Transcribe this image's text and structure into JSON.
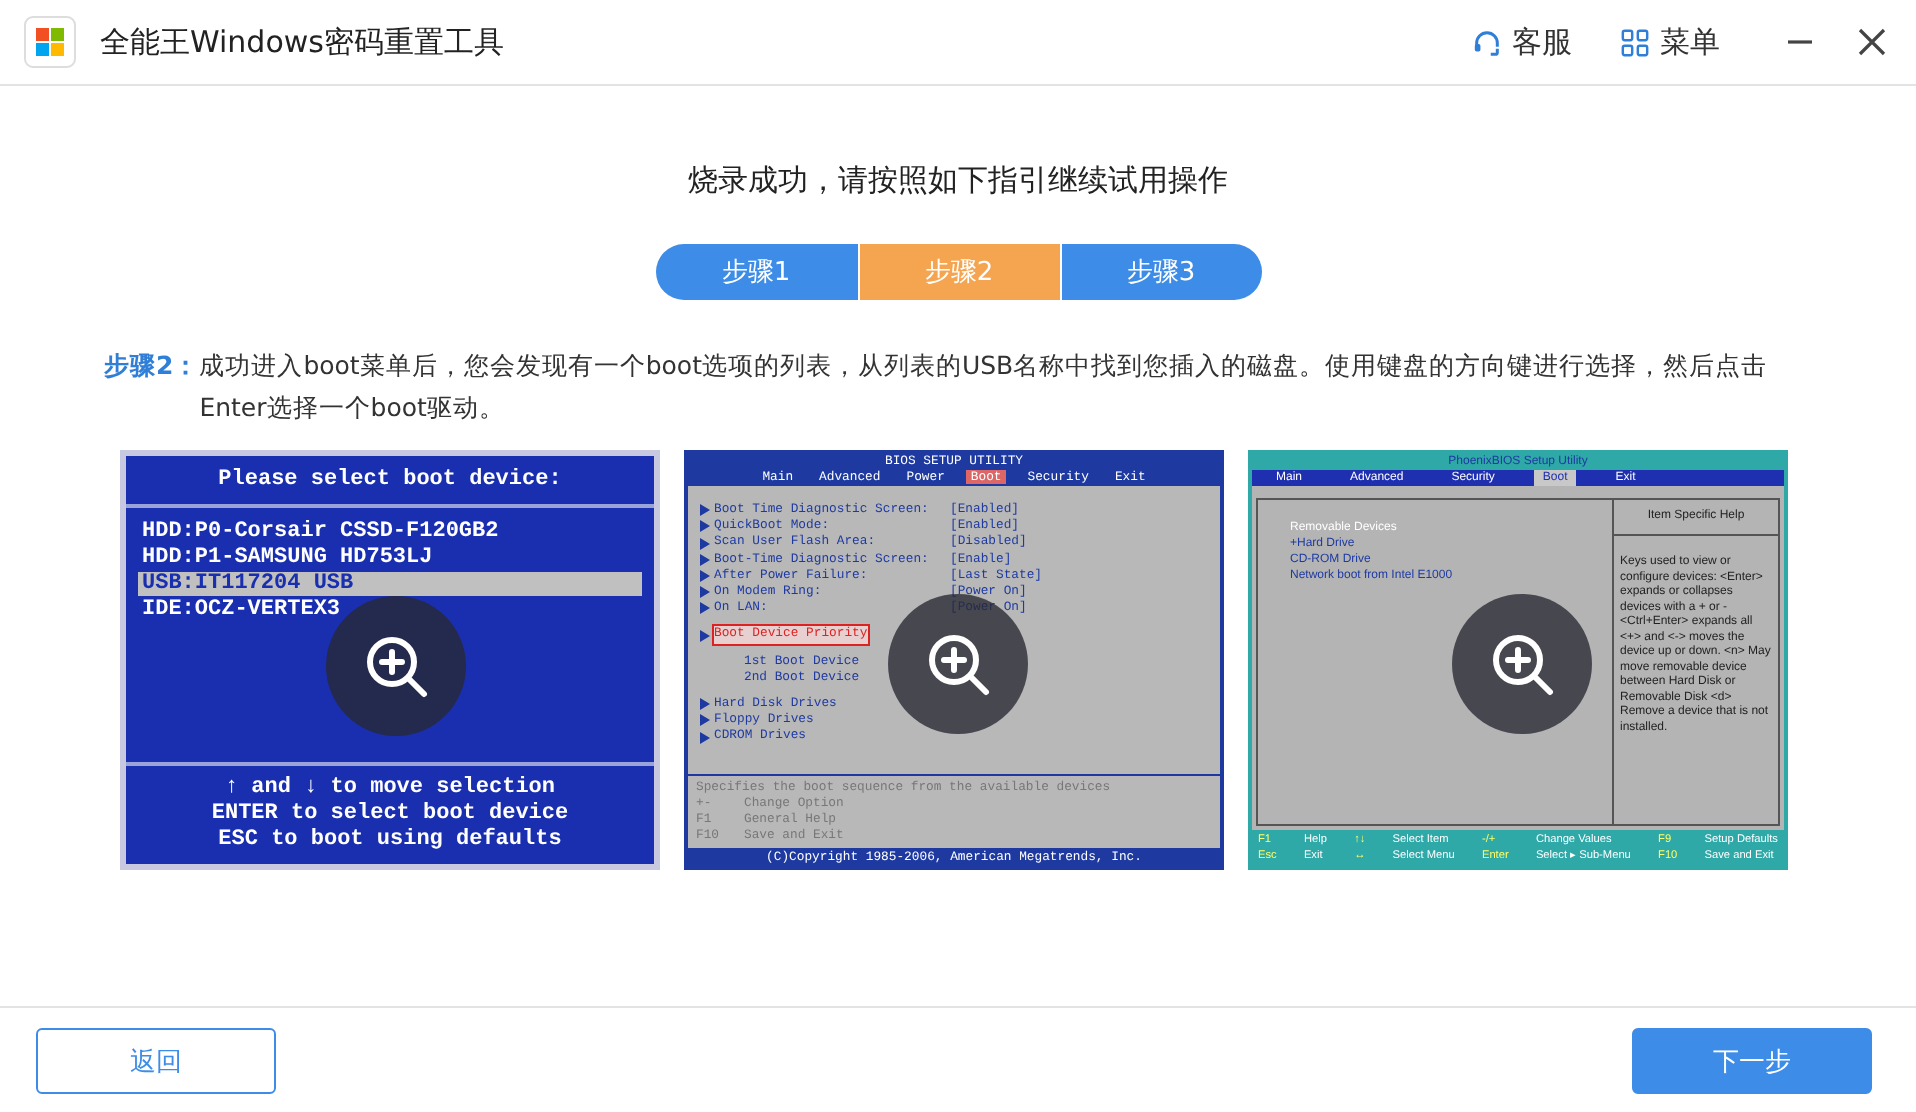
{
  "window": {
    "title": "全能王Windows密码重置工具",
    "actions": [
      {
        "label": "客服",
        "kind": "support"
      },
      {
        "label": "菜单",
        "kind": "menu"
      }
    ]
  },
  "heading": "烧录成功，请按照如下指引继续试用操作",
  "steps": [
    {
      "label": "步骤1",
      "selected": false
    },
    {
      "label": "步骤2",
      "selected": true
    },
    {
      "label": "步骤3",
      "selected": false
    }
  ],
  "instruction": {
    "label": "步骤2：",
    "text": "成功进入boot菜单后，您会发现有一个boot选项的列表，从列表的USB名称中找到您插入的磁盘。使用键盘的方向键进行选择，然后点击Enter选择一个boot驱动。"
  },
  "screenshots": [
    {
      "kind": "boot-menu",
      "title": "Please select boot device:",
      "items": [
        {
          "text": "HDD:P0-Corsair CSSD-F120GB2",
          "selected": false
        },
        {
          "text": "HDD:P1-SAMSUNG HD753LJ",
          "selected": false
        },
        {
          "text": "USB:IT117204 USB",
          "selected": true
        },
        {
          "text": "IDE:OCZ-VERTEX3",
          "selected": false
        }
      ],
      "footer": [
        "↑ and ↓ to move selection",
        "ENTER to select boot device",
        "ESC to boot using defaults"
      ]
    },
    {
      "kind": "ami",
      "title": "BIOS SETUP UTILITY",
      "tabs": [
        {
          "label": "Main",
          "selected": false
        },
        {
          "label": "Advanced",
          "selected": false
        },
        {
          "label": "Power",
          "selected": false
        },
        {
          "label": "Boot",
          "selected": true
        },
        {
          "label": "Security",
          "selected": false
        },
        {
          "label": "Exit",
          "selected": false
        }
      ],
      "groups": [
        {
          "items": [
            {
              "label": "Boot Time Diagnostic Screen:",
              "value": "[Enabled]",
              "kind": "arrow",
              "selected": false
            },
            {
              "label": "QuickBoot Mode:",
              "value": "[Enabled]",
              "kind": "arrow",
              "selected": false
            },
            {
              "label": "Scan User Flash Area:",
              "value": "[Disabled]",
              "kind": "arrow",
              "selected": false
            },
            {
              "label": "Boot-Time Diagnostic Screen:",
              "value": "[Enable]",
              "kind": "arrow",
              "selected": false
            },
            {
              "label": "After Power Failure:",
              "value": "[Last State]",
              "kind": "arrow",
              "selected": false
            },
            {
              "label": "On Modem Ring:",
              "value": "[Power On]",
              "kind": "arrow",
              "selected": false
            },
            {
              "label": "On LAN:",
              "value": "[Power On]",
              "kind": "arrow",
              "selected": false
            }
          ]
        },
        {
          "items": [
            {
              "label": "Boot Device Priority",
              "kind": "arrow",
              "selected": true
            }
          ]
        },
        {
          "items": [
            {
              "label": "1st Boot Device",
              "kind": "sub",
              "selected": false
            },
            {
              "label": "2nd Boot Device",
              "kind": "sub",
              "selected": false
            }
          ]
        },
        {
          "items": [
            {
              "label": "Hard Disk Drives",
              "kind": "arrow",
              "selected": false
            },
            {
              "label": "Floppy Drives",
              "kind": "arrow",
              "selected": false
            },
            {
              "label": "CDROM Drives",
              "kind": "arrow",
              "selected": false
            }
          ]
        }
      ],
      "hint": "Specifies the boot sequence from the available devices",
      "keys": [
        {
          "key": "+-",
          "action": "Change Option"
        },
        {
          "key": "F1",
          "action": "General Help"
        },
        {
          "key": "F10",
          "action": "Save and Exit"
        }
      ],
      "copyright": "(C)Copyright 1985-2006, American Megatrends, Inc."
    },
    {
      "kind": "phoenix",
      "title": "PhoenixBIOS Setup Utility",
      "tabs": [
        {
          "label": "Main",
          "selected": false
        },
        {
          "label": "Advanced",
          "selected": false
        },
        {
          "label": "Security",
          "selected": false
        },
        {
          "label": "Boot",
          "selected": true
        },
        {
          "label": "Exit",
          "selected": false
        }
      ],
      "items": [
        {
          "text": "Removable Devices",
          "selected": true
        },
        {
          "text": "+Hard Drive",
          "selected": false
        },
        {
          "text": "CD-ROM Drive",
          "selected": false
        },
        {
          "text": "Network boot from Intel E1000",
          "selected": false
        }
      ],
      "help_title": "Item Specific Help",
      "help": "Keys used to view or configure devices: <Enter> expands or collapses devices with a + or - <Ctrl+Enter> expands all <+> and <-> moves the device up or down. <n> May move removable device between Hard Disk or Removable Disk <d> Remove a device that is not installed.",
      "keys": [
        {
          "key": "F1",
          "action": "Help"
        },
        {
          "key": "↑↓",
          "action": "Select Item"
        },
        {
          "key": "-/+",
          "action": "Change Values"
        },
        {
          "key": "F9",
          "action": "Setup Defaults"
        },
        {
          "key": "Esc",
          "action": "Exit"
        },
        {
          "key": "↔",
          "action": "Select Menu"
        },
        {
          "key": "Enter",
          "action": "Select ▸ Sub-Menu"
        },
        {
          "key": "F10",
          "action": "Save and Exit"
        }
      ]
    }
  ],
  "buttons": [
    {
      "label": "返回",
      "kind": "secondary"
    },
    {
      "label": "下一步",
      "kind": "primary"
    }
  ]
}
